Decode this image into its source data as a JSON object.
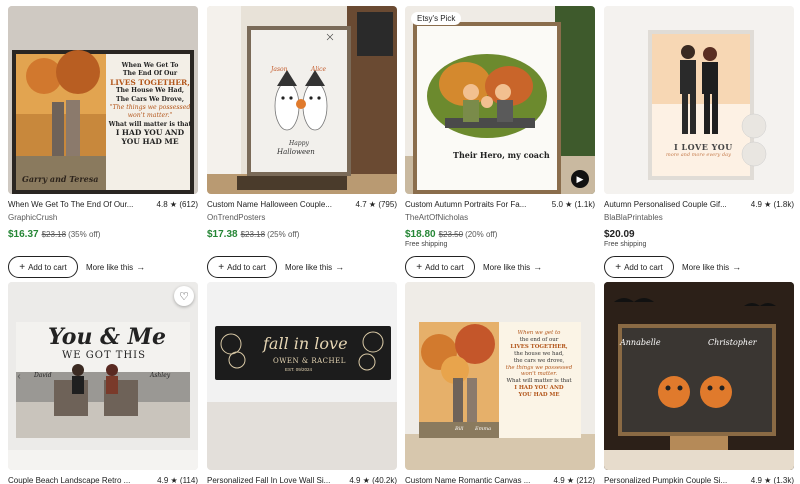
{
  "colors": {
    "sale_price": "#258635",
    "text": "#222222",
    "muted": "#595959"
  },
  "products": [
    {
      "title": "When We Get To The End Of Our...",
      "rating": "4.8",
      "reviews": "(612)",
      "shop": "GraphicCrush",
      "price": "$16.37",
      "original_price": "$23.18",
      "discount": "(35% off)",
      "shipping": "",
      "image_text": {
        "lines": [
          "When We Get To",
          "The End Of Our",
          "LIVES TOGETHER,",
          "The House We Had,",
          "The Cars We Drove,",
          "\"The things we possessed",
          "won't matter.\"",
          "What will matter is that",
          "I HAD YOU AND",
          "YOU HAD ME"
        ],
        "names": "Garry and Teresa"
      }
    },
    {
      "title": "Custom Name Halloween Couple...",
      "rating": "4.7",
      "reviews": "(795)",
      "shop": "OnTrendPosters",
      "price": "$17.38",
      "original_price": "$23.18",
      "discount": "(25% off)",
      "shipping": "",
      "image_text": {
        "name1": "Jason",
        "name2": "Alice",
        "caption1": "Happy",
        "caption2": "Halloween"
      }
    },
    {
      "title": "Custom Autumn Portraits For Fa...",
      "rating": "5.0",
      "reviews": "(1.1k)",
      "shop": "TheArtOfNicholas",
      "price": "$18.80",
      "original_price": "$23.50",
      "discount": "(20% off)",
      "shipping": "Free shipping",
      "badge": "Etsy's Pick",
      "image_text": {
        "caption": "Their Hero, my coach"
      }
    },
    {
      "title": "Autumn Personalised Couple Gif...",
      "rating": "4.9",
      "reviews": "(1.8k)",
      "shop": "BlaBlaPrintables",
      "price": "$20.09",
      "original_price": "",
      "discount": "",
      "shipping": "Free shipping",
      "image_text": {
        "line1": "I LOVE YOU",
        "line2": "more and more every day"
      }
    },
    {
      "title": "Couple Beach Landscape Retro ...",
      "rating": "4.9",
      "reviews": "(114)",
      "image_text": {
        "line1": "You & Me",
        "line2": "WE GOT THIS",
        "name1": "David",
        "name2": "Ashley"
      }
    },
    {
      "title": "Personalized Fall In Love Wall Si...",
      "rating": "4.9",
      "reviews": "(40.2k)",
      "image_text": {
        "line1": "fall in love",
        "line2": "OWEN & RACHEL",
        "line3": "EST. 09/2024"
      }
    },
    {
      "title": "Custom Name Romantic Canvas ...",
      "rating": "4.9",
      "reviews": "(212)",
      "image_text": {
        "lines": [
          "When we get to",
          "the end of our",
          "LIVES TOGETHER,",
          "the house we had,",
          "the cars we drove,",
          "the things we possessed",
          "won't matter.",
          "What will matter is that",
          "I HAD YOU AND",
          "YOU HAD ME"
        ],
        "name1": "Bill",
        "name2": "Emma"
      }
    },
    {
      "title": "Personalized Pumpkin Couple Si...",
      "rating": "4.9",
      "reviews": "(1.3k)",
      "image_text": {
        "name1": "Annabelle",
        "name2": "Christopher"
      }
    }
  ],
  "labels": {
    "add_to_cart": "Add to cart",
    "more_like_this": "More like this"
  },
  "icons": {
    "star": "★",
    "plus": "+",
    "arrow": "→",
    "play": "▶",
    "heart": "♡",
    "prev": "‹"
  }
}
